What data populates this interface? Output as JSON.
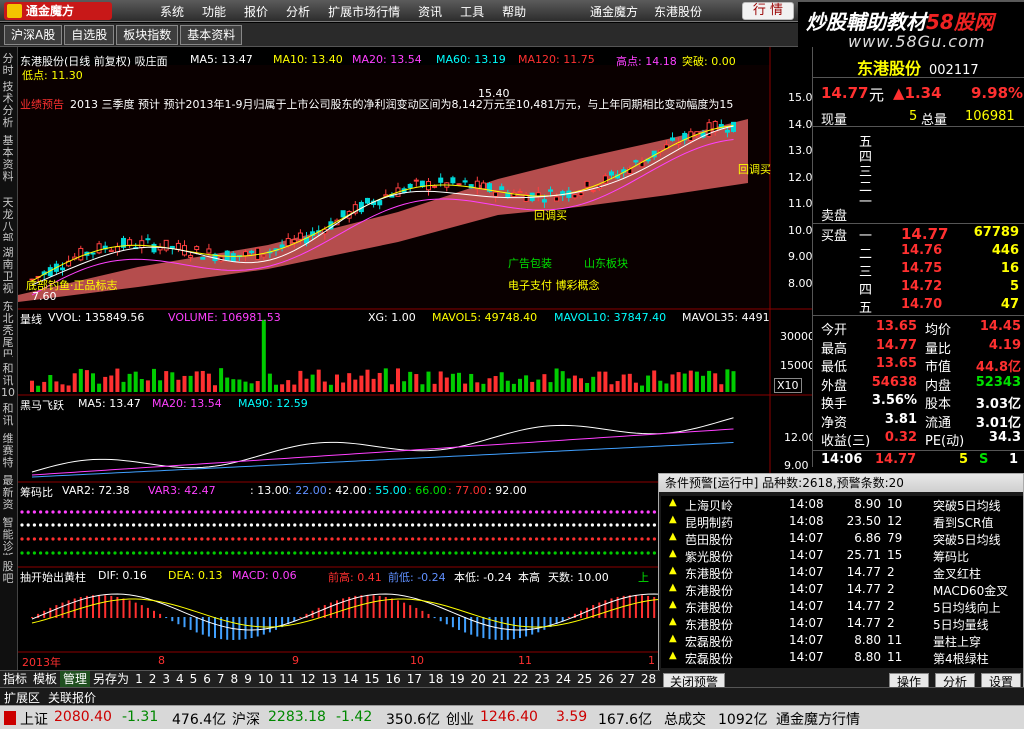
{
  "app": {
    "logo": "通金魔方",
    "logo_sub": "www.mtfxxu.com",
    "menu": [
      "系统",
      "功能",
      "报价",
      "分析",
      "扩展市场行情",
      "资讯",
      "工具",
      "帮助"
    ],
    "right_menu": [
      "通金魔方",
      "东港股份"
    ],
    "quote_button": "行 情",
    "win_controls": [
      "_",
      "□",
      "×"
    ]
  },
  "watermark": {
    "line1": "炒股輔助教材",
    "line1_red": "58股网",
    "line2": "www.58Gu.com"
  },
  "tabs": [
    "沪深A股",
    "自选股",
    "板块指数",
    "基本资料"
  ],
  "left_tabs": [
    "分时走势",
    "技术分析",
    "基本资料",
    "天龙八部",
    "湖南卫视",
    "东北秃尾巴",
    "和讯10",
    "和讯10",
    "维赛特",
    "最新资讯",
    "智能诊断",
    "股吧"
  ],
  "chart": {
    "header": {
      "title": "东港股份(日线 前复权) 吸庄面",
      "ma5": "MA5: 13.47",
      "ma10": "MA10: 13.40",
      "ma20": "MA20: 13.54",
      "ma60": "MA60: 13.19",
      "ma120": "MA120: 11.75",
      "high_label": "高点: 14.18",
      "break_label": "突破: 0.00",
      "low_label": "低点: 11.30"
    },
    "news": "2013 三季度 预计 预计2013年1-9月归属于上市公司股东的净利润变动区间为8,142万元至10,481万元，与上年同期相比变动幅度为15",
    "news_prefix": "业绩预告",
    "y_ticks": [
      "15.00",
      "14.00",
      "13.00",
      "12.00",
      "11.00",
      "10.00",
      "9.00",
      "8.00"
    ],
    "annotations": {
      "peak": "15.40",
      "rebuy": "回调买",
      "callback": "回调买",
      "note1": "广告包装",
      "note2": "山东板块",
      "note3": "电子支付 博彩概念",
      "bottom_note": "底部钓鱼·正品标志",
      "bottom_price": "7.60"
    },
    "volume": {
      "label": "量线",
      "vvol": "VVOL: 135849.56",
      "volume": "VOLUME: 106981.53",
      "xg": "XG: 1.00",
      "mavol5": "MAVOL5: 49748.40",
      "mavol10": "MAVOL10: 37847.40",
      "mavol35": "MAVOL35: 4491",
      "ticks": [
        "30000",
        "15000"
      ],
      "unit": "X10"
    },
    "horse": {
      "label": "黑马飞跃",
      "ma5": "MA5: 13.47",
      "ma20": "MA20: 13.54",
      "ma90": "MA90: 12.59",
      "tick": "12.00",
      "tick2": "9.00"
    },
    "chip": {
      "label": "筹码比",
      "var2": "VAR2: 72.38",
      "var3": "VAR3: 42.47",
      "v1": ": 13.00",
      "v2": ": 22.00",
      "v3": ": 42.00",
      "v4": ": 55.00",
      "v5": ": 66.00",
      "v6": ": 77.00",
      "v7": ": 92.00"
    },
    "macd": {
      "label": "抽开始出黄柱",
      "dif": "DIF: 0.16",
      "dea": "DEA: 0.13",
      "macd": "MACD: 0.06",
      "prev_high": "前高: 0.41",
      "prev_low": "前低: -0.24",
      "this_low": "本低: -0.24",
      "this_high": "本高",
      "days": "天数: 10.00",
      "up": "上"
    },
    "months": [
      "2013年",
      "8",
      "9",
      "10",
      "11",
      "1"
    ]
  },
  "stock": {
    "name": "东港股份",
    "code": "002117",
    "price": "14.77",
    "unit": "元",
    "change": "▲1.34",
    "pct": "9.98%",
    "now_label": "现量",
    "now_vol": "5",
    "total_label": "总量",
    "total_vol": "106981",
    "sell": [
      {
        "l": "五",
        "p": "",
        "v": ""
      },
      {
        "l": "四",
        "p": "",
        "v": ""
      },
      {
        "l": "三",
        "p": "",
        "v": ""
      },
      {
        "l": "二",
        "p": "",
        "v": ""
      },
      {
        "l": "一",
        "p": "",
        "v": ""
      }
    ],
    "sell_label": "卖盘",
    "buy_label": "买盘",
    "buy": [
      {
        "l": "一",
        "p": "14.77",
        "v": "67789"
      },
      {
        "l": "二",
        "p": "14.76",
        "v": "446"
      },
      {
        "l": "三",
        "p": "14.75",
        "v": "16"
      },
      {
        "l": "四",
        "p": "14.72",
        "v": "5"
      },
      {
        "l": "五",
        "p": "14.70",
        "v": "47"
      }
    ],
    "stats": [
      {
        "a": "今开",
        "av": "13.65",
        "b": "均价",
        "bv": "14.45"
      },
      {
        "a": "最高",
        "av": "14.77",
        "b": "量比",
        "bv": "4.19"
      },
      {
        "a": "最低",
        "av": "13.65",
        "b": "市值",
        "bv": "44.8亿"
      },
      {
        "a": "外盘",
        "av": "54638",
        "b": "内盘",
        "bv": "52343"
      },
      {
        "a": "换手",
        "av": "3.56%",
        "b": "股本",
        "bv": "3.03亿"
      },
      {
        "a": "净资",
        "av": "3.81",
        "b": "流通",
        "bv": "3.01亿"
      },
      {
        "a": "收益(三)",
        "av": "0.32",
        "b": "PE(动)",
        "bv": "34.3"
      }
    ],
    "tick": {
      "time": "14:06",
      "price": "14.77",
      "vol": "5",
      "flag": "S",
      "n": "1"
    }
  },
  "alert": {
    "title": "条件预警[运行中] 品种数:2618,预警条数:20",
    "rows": [
      {
        "name": "上海贝岭",
        "time": "14:08",
        "price": "8.90",
        "n": "10",
        "cond": "突破5日均线"
      },
      {
        "name": "昆明制药",
        "time": "14:08",
        "price": "23.50",
        "n": "12",
        "cond": "看到SCR值"
      },
      {
        "name": "芭田股份",
        "time": "14:07",
        "price": "6.86",
        "n": "79",
        "cond": "突破5日均线"
      },
      {
        "name": "紫光股份",
        "time": "14:07",
        "price": "25.71",
        "n": "15",
        "cond": "筹码比"
      },
      {
        "name": "东港股份",
        "time": "14:07",
        "price": "14.77",
        "n": "2",
        "cond": "金叉红柱"
      },
      {
        "name": "东港股份",
        "time": "14:07",
        "price": "14.77",
        "n": "2",
        "cond": "MACD60金叉"
      },
      {
        "name": "东港股份",
        "time": "14:07",
        "price": "14.77",
        "n": "2",
        "cond": "5日均线向上"
      },
      {
        "name": "东港股份",
        "time": "14:07",
        "price": "14.77",
        "n": "2",
        "cond": "5日均量线"
      },
      {
        "name": "宏磊股份",
        "time": "14:07",
        "price": "8.80",
        "n": "11",
        "cond": "量柱上穿"
      },
      {
        "name": "宏磊股份",
        "time": "14:07",
        "price": "8.80",
        "n": "11",
        "cond": "第4根绿柱"
      }
    ],
    "btn_close": "关闭预警",
    "btn_op": "操作",
    "btn_analyze": "分析",
    "btn_set": "设置"
  },
  "bottom": {
    "tabs": [
      "指标",
      "模板",
      "管理",
      "另存为",
      "1",
      "2",
      "3",
      "4",
      "5",
      "6",
      "7",
      "8",
      "9",
      "10",
      "11",
      "12",
      "13",
      "14",
      "15",
      "16",
      "17",
      "18",
      "19",
      "20",
      "21",
      "22",
      "23",
      "24",
      "25",
      "26",
      "27",
      "28"
    ],
    "tabs2": [
      "扩展区",
      "关联报价"
    ]
  },
  "status": {
    "sh_label": "上证",
    "sh": "2080.40",
    "sh_chg": "-1.31",
    "sh_amt": "476.4亿",
    "hs_label": "沪深",
    "hs": "2283.18",
    "hs_chg": "-1.42",
    "hs_amt": "350.6亿",
    "cy_label": "创业",
    "cy": "1246.40",
    "cy_chg": "3.59",
    "cy_amt": "167.6亿",
    "total_label": "总成交",
    "total": "1092亿",
    "provider": "通金魔方行情"
  }
}
